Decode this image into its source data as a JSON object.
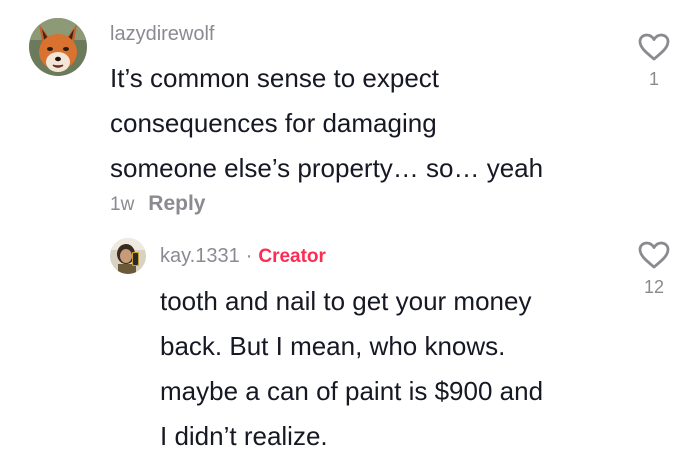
{
  "comments": [
    {
      "username": "lazydirewolf",
      "lines": [
        "It’s common sense to expect",
        "consequences for damaging",
        "someone else’s property… so… yeah"
      ],
      "time": "1w",
      "reply_label": "Reply",
      "like_count": "1",
      "avatar_icon": "fox-avatar"
    },
    {
      "username": "kay.1331",
      "separator": "·",
      "badge": "Creator",
      "lines": [
        "tooth and nail to get your money",
        "back. But I mean, who knows.",
        "maybe a can of paint is $900 and",
        "I didn’t realize."
      ],
      "like_count": "12",
      "avatar_icon": "selfie-avatar"
    }
  ],
  "colors": {
    "text": "#161823",
    "muted": "#8a8b91",
    "creator": "#fe2c55"
  },
  "icons": {
    "like": "heart-outline-icon"
  }
}
